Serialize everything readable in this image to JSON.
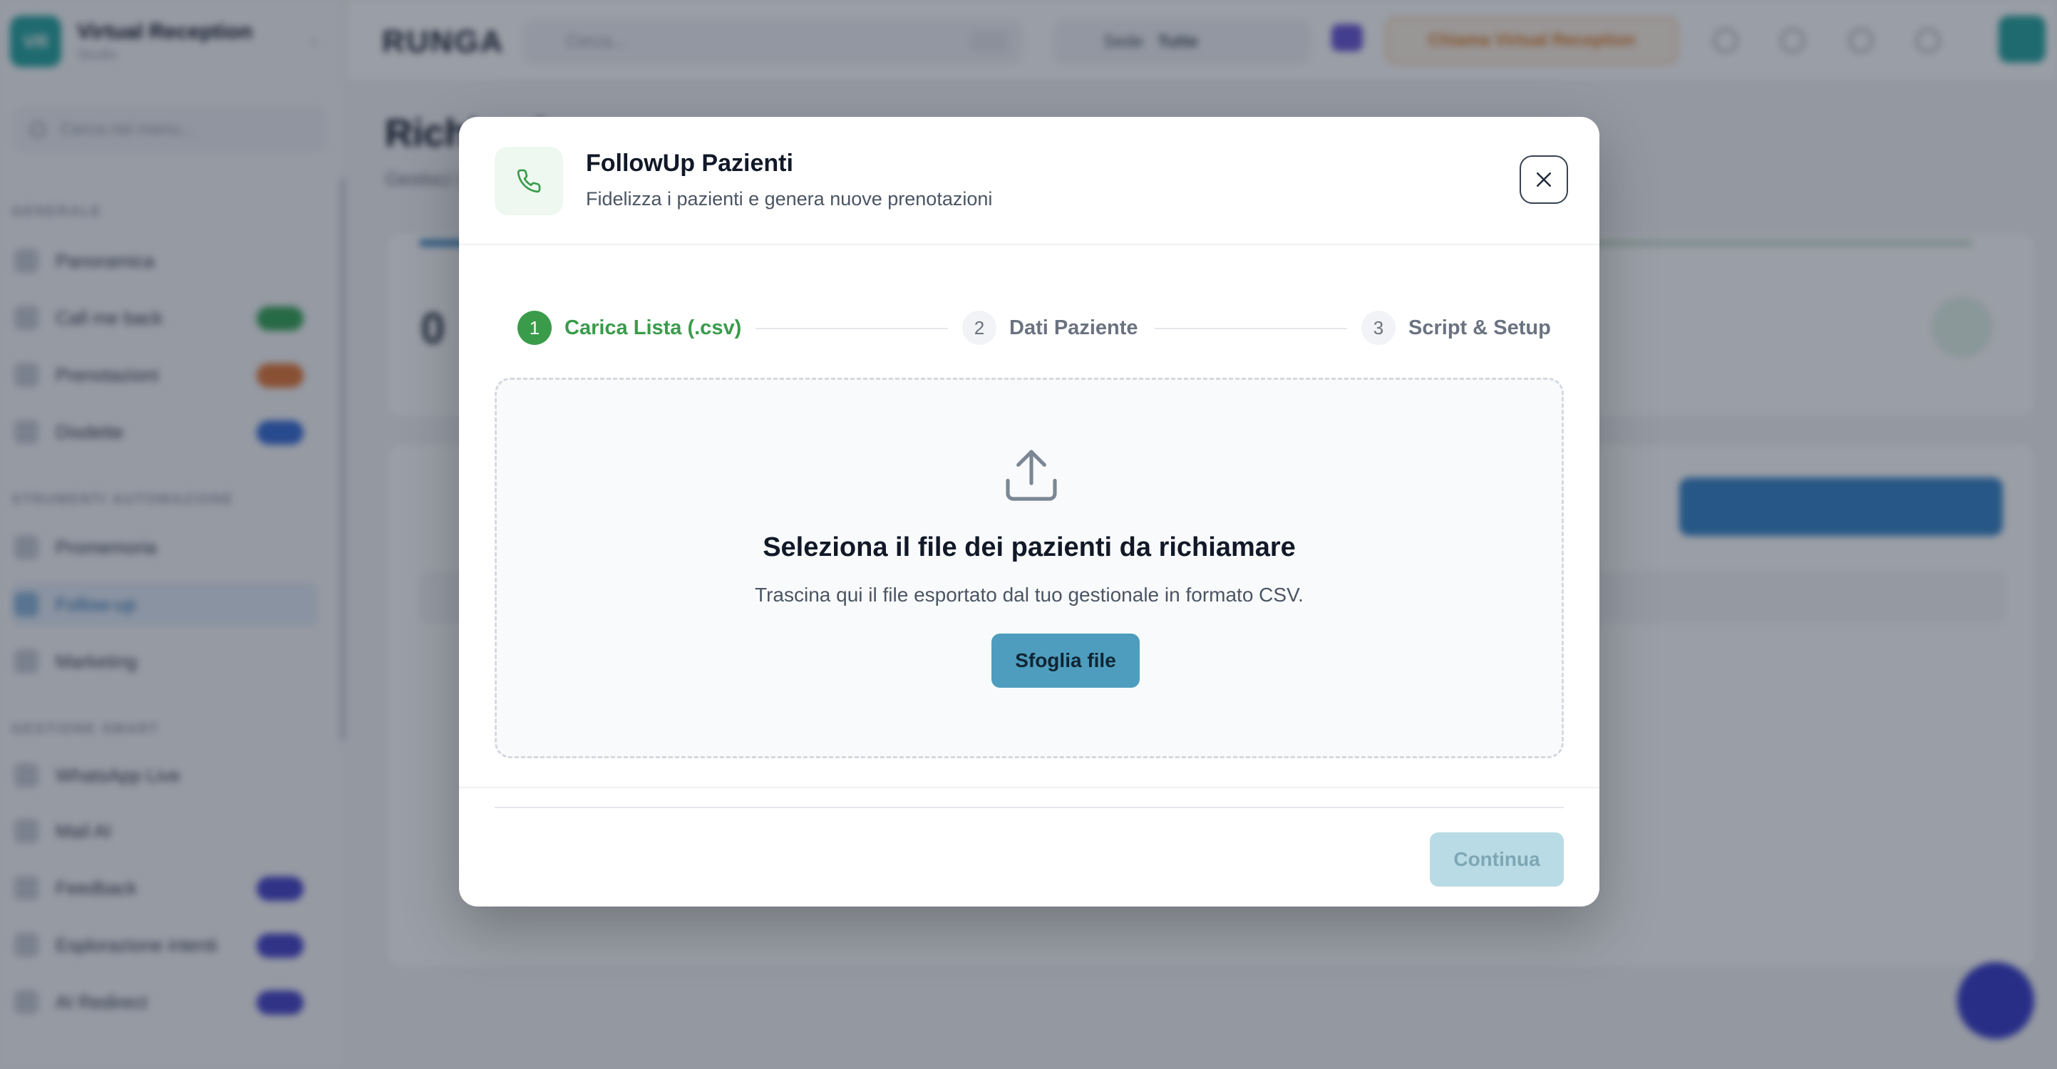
{
  "app": {
    "brand_title": "Virtual Reception",
    "brand_subtitle": "Studio",
    "sidebar_search_placeholder": "Cerca nel menu...",
    "sections": [
      "GENERALE",
      "STRUMENTI AUTOMAZIONE",
      "GESTIONE SMART"
    ],
    "sidebar_items": [
      {
        "label": "Panoramica"
      },
      {
        "label": "Call me back"
      },
      {
        "label": "Prenotazioni"
      },
      {
        "label": "Disdette"
      },
      {
        "label": "Promemoria"
      },
      {
        "label": "Follow-up"
      },
      {
        "label": "Marketing"
      },
      {
        "label": "WhatsApp Live"
      },
      {
        "label": "Mail AI"
      },
      {
        "label": "Feedback"
      },
      {
        "label": "Esplorazione intenti"
      },
      {
        "label": "AI Redirect"
      }
    ],
    "topbar": {
      "logo": "RUNGA",
      "search_placeholder": "Cerca...",
      "filter_label": "Sede",
      "filter_value": "Tutte",
      "cta_label": "Chiama Virtual Reception"
    },
    "page_title": "Richiami",
    "page_subtitle": "Gestisci i richiami dei pazienti",
    "stat_value": "0"
  },
  "modal": {
    "title": "FollowUp Pazienti",
    "subtitle": "Fidelizza i pazienti e genera nuove prenotazioni",
    "steps": [
      {
        "num": "1",
        "label": "Carica Lista (.csv)"
      },
      {
        "num": "2",
        "label": "Dati Paziente"
      },
      {
        "num": "3",
        "label": "Script & Setup"
      }
    ],
    "dropzone": {
      "title": "Seleziona il file dei pazienti da richiamare",
      "description": "Trascina qui il file esportato dal tuo gestionale in formato CSV.",
      "browse_label": "Sfoglia file"
    },
    "continue_label": "Continua"
  },
  "colors": {
    "accent_green": "#3a9b4b",
    "accent_teal": "#4e9dbe",
    "disabled_button": "#b9dbe5"
  }
}
